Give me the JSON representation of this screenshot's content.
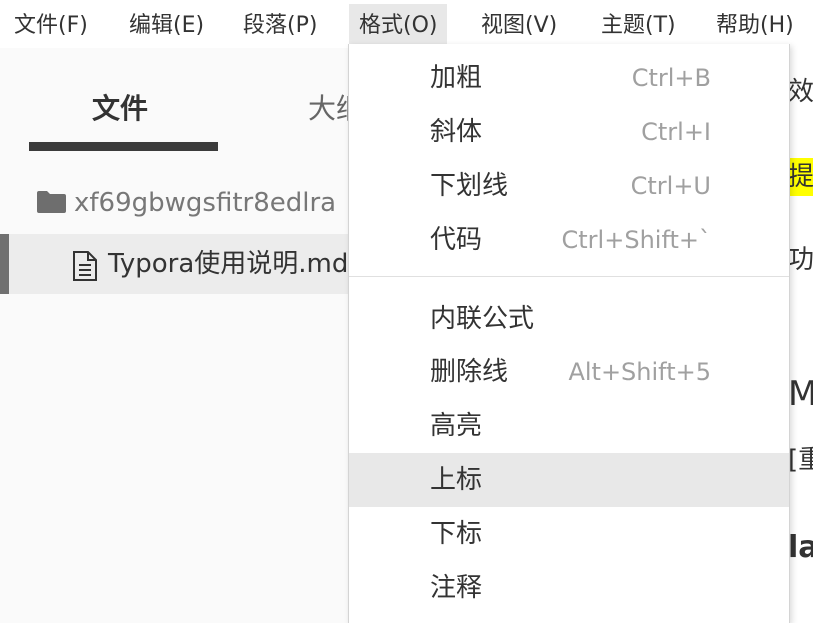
{
  "menubar": {
    "items": [
      {
        "label": "文件(F)"
      },
      {
        "label": "编辑(E)"
      },
      {
        "label": "段落(P)"
      },
      {
        "label": "格式(O)"
      },
      {
        "label": "视图(V)"
      },
      {
        "label": "主题(T)"
      },
      {
        "label": "帮助(H)"
      }
    ]
  },
  "sidebar": {
    "tabs": [
      {
        "label": "文件"
      },
      {
        "label": "大纲"
      }
    ],
    "folder": {
      "label": "xf69gbwgsfitr8edlra"
    },
    "file": {
      "label": "Typora使用说明.md"
    }
  },
  "editor": {
    "fragments": [
      "效果",
      "提重",
      "功能",
      "Ma",
      "[重",
      "la"
    ]
  },
  "format_menu": {
    "items": [
      {
        "label": "加粗",
        "shortcut": "Ctrl+B"
      },
      {
        "label": "斜体",
        "shortcut": "Ctrl+I"
      },
      {
        "label": "下划线",
        "shortcut": "Ctrl+U"
      },
      {
        "label": "代码",
        "shortcut": "Ctrl+Shift+`"
      },
      {
        "label": "内联公式",
        "shortcut": ""
      },
      {
        "label": "删除线",
        "shortcut": "Alt+Shift+5"
      },
      {
        "label": "高亮",
        "shortcut": ""
      },
      {
        "label": "上标",
        "shortcut": ""
      },
      {
        "label": "下标",
        "shortcut": ""
      },
      {
        "label": "注释",
        "shortcut": ""
      }
    ]
  },
  "colors": {
    "highlight": "#ffff00",
    "menu_hover": "#e8e8e8",
    "shortcut_text": "#a0a0a0"
  }
}
